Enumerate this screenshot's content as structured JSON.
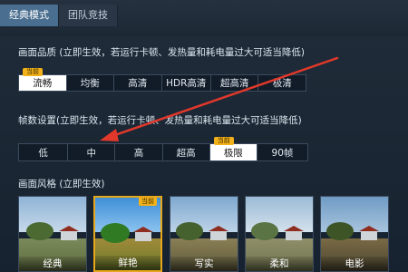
{
  "tabs": [
    {
      "label": "经典模式",
      "active": true
    },
    {
      "label": "团队竞技",
      "active": false
    }
  ],
  "quality": {
    "label": "画面品质 (立即生效，若运行卡顿、发热量和耗电量过大可适当降低)",
    "badge": "当前",
    "options": [
      "流畅",
      "均衡",
      "高清",
      "HDR高清",
      "超高清",
      "极清"
    ],
    "selected": "流畅"
  },
  "fps": {
    "label": "帧数设置(立即生效，若运行卡顿、发热量和耗电量过大可适当降低)",
    "badge": "当前",
    "options": [
      "低",
      "中",
      "高",
      "超高",
      "极限",
      "90帧"
    ],
    "selected": "极限"
  },
  "style": {
    "label": "画面风格 (立即生效)",
    "badge": "当前",
    "options": [
      "经典",
      "鲜艳",
      "写实",
      "柔和",
      "电影"
    ],
    "selected": "鲜艳"
  },
  "colors": {
    "accent": "#f3b21a",
    "annotation_arrow": "#e2382b",
    "selected_option_bg": "#ffffff"
  }
}
